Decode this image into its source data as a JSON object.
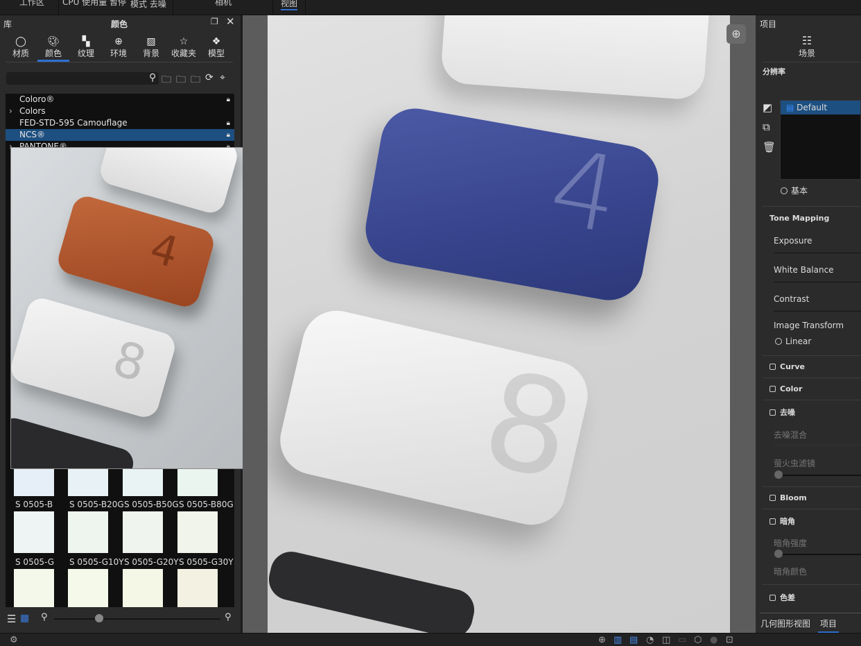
{
  "topbar": {
    "items": [
      "工作区",
      "CPU 使用量 暂停",
      "模式 去噪",
      "相机",
      "视图"
    ]
  },
  "library": {
    "title": "库",
    "panel_title": "颜色",
    "categories": [
      {
        "label": "材质",
        "icon": "material-ball-icon"
      },
      {
        "label": "颜色",
        "icon": "palette-icon"
      },
      {
        "label": "纹理",
        "icon": "texture-checker-icon"
      },
      {
        "label": "环境",
        "icon": "globe-icon"
      },
      {
        "label": "背景",
        "icon": "image-icon"
      },
      {
        "label": "收藏夹",
        "icon": "star-icon"
      },
      {
        "label": "模型",
        "icon": "cubes-icon"
      }
    ],
    "active_category": "颜色",
    "search_placeholder": "",
    "tree": [
      {
        "label": "Coloro®",
        "locked": true,
        "expandable": false
      },
      {
        "label": "Colors",
        "locked": false,
        "expandable": true
      },
      {
        "label": "FED-STD-595 Camouflage",
        "locked": true,
        "expandable": false
      },
      {
        "label": "NCS®",
        "locked": true,
        "expandable": false,
        "selected": true
      },
      {
        "label": "PANTONE®",
        "locked": true,
        "expandable": true
      }
    ],
    "swatches": [
      {
        "label": "S 0505-B",
        "color": "#e6eef7"
      },
      {
        "label": "S 0505-B20G",
        "color": "#e8f1f6"
      },
      {
        "label": "S 0505-B50G",
        "color": "#e9f3f3"
      },
      {
        "label": "S 0505-B80G",
        "color": "#ebf5f0"
      },
      {
        "label": "S 0505-G",
        "color": "#edf4f3"
      },
      {
        "label": "S 0505-G10Y",
        "color": "#eef5ef"
      },
      {
        "label": "S 0505-G20Y",
        "color": "#eff5ee"
      },
      {
        "label": "S 0505-G30Y",
        "color": "#f0f4ea"
      },
      {
        "label": "",
        "color": "#f3f8ea"
      },
      {
        "label": "",
        "color": "#f5f9e9"
      },
      {
        "label": "",
        "color": "#f5f7e6"
      },
      {
        "label": "",
        "color": "#f3f2e2"
      }
    ],
    "preview_digits": [
      "4",
      "8"
    ]
  },
  "render": {
    "digits": [
      "4",
      "8"
    ]
  },
  "project": {
    "title": "项目",
    "tab_scene": "场景",
    "resolution_label": "分辨率",
    "preset": "Default",
    "basic_label": "基本",
    "tone_mapping": "Tone Mapping",
    "exposure": "Exposure",
    "white_balance": "White Balance",
    "contrast": "Contrast",
    "image_transform": "Image Transform",
    "linear": "Linear",
    "curve": "Curve",
    "color": "Color",
    "denoise": "去噪",
    "denoise_blend": "去噪混合",
    "firefly": "萤火虫滤镜",
    "bloom": "Bloom",
    "vignette": "暗角",
    "vignette_strength": "暗角强度",
    "vignette_color": "暗角颜色",
    "chromatic": "色差",
    "bottom_tabs": [
      "几何图形视图",
      "项目"
    ],
    "active_bottom_tab": "项目"
  },
  "colors": {
    "accent": "#2f6fd0",
    "selection": "#1d4f80",
    "blue_tile": "#3a4a94",
    "orange_tile": "#b5532a"
  }
}
